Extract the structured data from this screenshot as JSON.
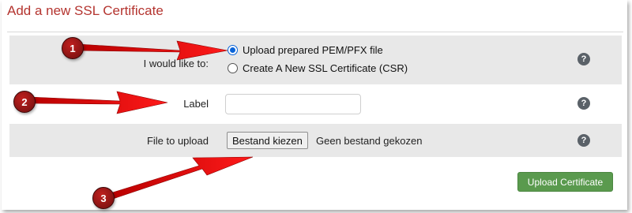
{
  "page": {
    "title": "Add a new SSL Certificate"
  },
  "form": {
    "mode": {
      "label": "I would like to:",
      "options": [
        {
          "label": "Upload prepared PEM/PFX file",
          "checked": true
        },
        {
          "label": "Create A New SSL Certificate (CSR)",
          "checked": false
        }
      ]
    },
    "label_field": {
      "label": "Label",
      "value": "",
      "placeholder": ""
    },
    "file": {
      "label": "File to upload",
      "button_label": "Bestand kiezen",
      "status": "Geen bestand gekozen"
    },
    "help_glyph": "?",
    "submit_label": "Upload Certificate"
  },
  "annotations": {
    "color": "#e01010",
    "badges": [
      "1",
      "2",
      "3"
    ]
  }
}
